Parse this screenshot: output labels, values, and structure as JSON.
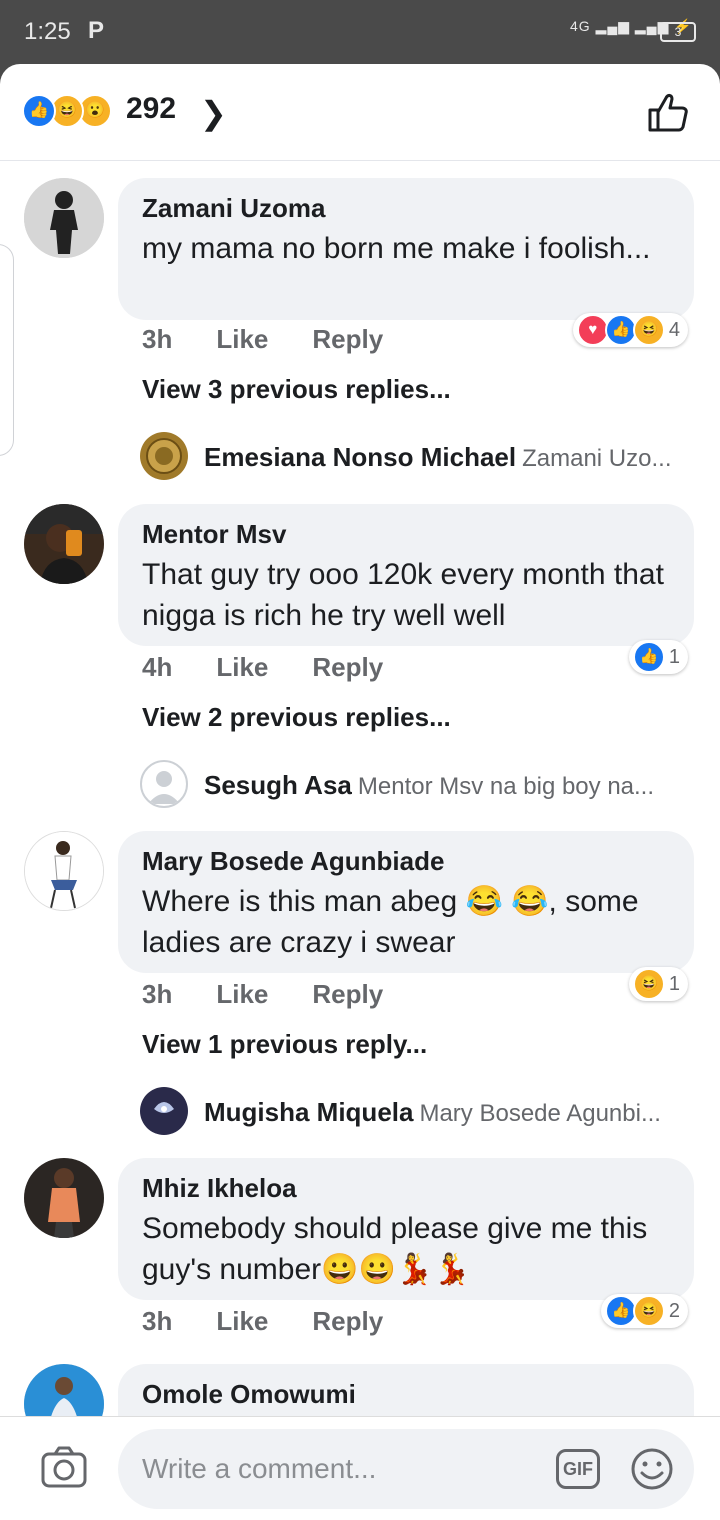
{
  "status_bar": {
    "time": "1:25",
    "network": "4G",
    "battery": "3"
  },
  "header": {
    "reaction_count": "292"
  },
  "comments": [
    {
      "name": "Zamani Uzoma",
      "text": "my mama no born me make i foolish...",
      "time": "3h",
      "like": "Like",
      "reply": "Reply",
      "reaction_count": "4",
      "view_previous": "View 3 previous replies...",
      "latest_reply": {
        "name": "Emesiana Nonso Michael",
        "text": "Zamani Uzo..."
      }
    },
    {
      "name": "Mentor Msv",
      "text": "That guy try ooo 120k every month that nigga is rich he try well well",
      "time": "4h",
      "like": "Like",
      "reply": "Reply",
      "reaction_count": "1",
      "view_previous": "View 2 previous replies...",
      "latest_reply": {
        "name": "Sesugh Asa",
        "text": "Mentor Msv na big boy na..."
      }
    },
    {
      "name": "Mary Bosede Agunbiade",
      "text": "Where is this man abeg 😂 😂, some ladies are crazy i swear",
      "time": "3h",
      "like": "Like",
      "reply": "Reply",
      "reaction_count": "1",
      "view_previous": "View 1 previous reply...",
      "latest_reply": {
        "name": "Mugisha Miquela",
        "text": "Mary Bosede Agunbi..."
      }
    },
    {
      "name": "Mhiz Ikheloa",
      "text": "Somebody should please give me this guy's number😀😀💃💃",
      "time": "3h",
      "like": "Like",
      "reply": "Reply",
      "reaction_count": "2"
    },
    {
      "name": "Omole Omowumi"
    }
  ],
  "composer": {
    "placeholder": "Write a comment...",
    "gif_label": "GIF"
  }
}
